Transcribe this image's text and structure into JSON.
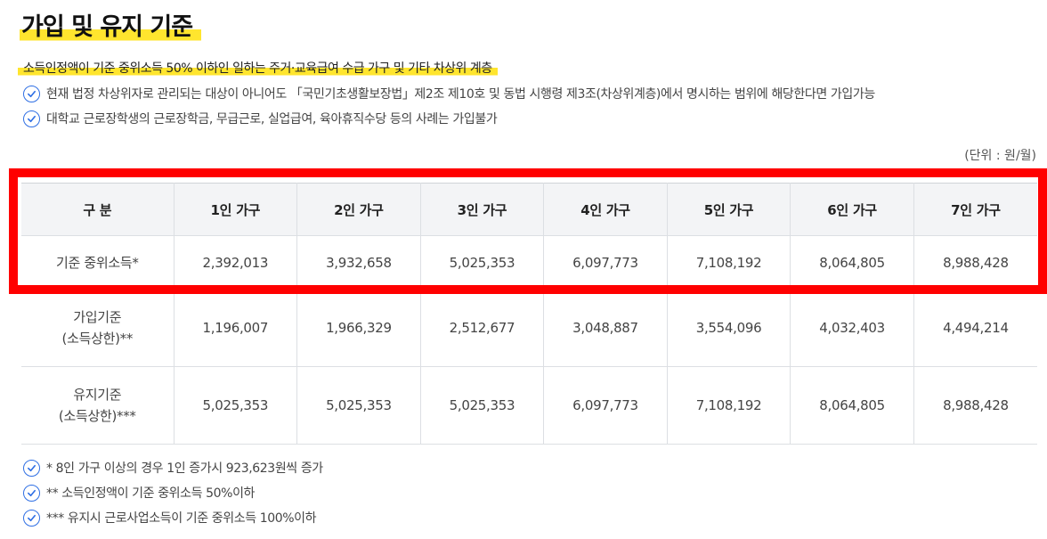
{
  "title": "가입 및 유지 기준",
  "subtitle": "소득인정액이 기준 중위소득 50% 이하인 일하는 주거·교육급여 수급 가구 및 기타 차상위 계층",
  "top_notes": [
    "현재 법정 차상위자로 관리되는 대상이 아니어도 「국민기초생활보장법」제2조 제10호 및 동법 시행령 제3조(차상위계층)에서 명시하는 범위에 해당한다면 가입가능",
    "대학교 근로장학생의 근로장학금, 무급근로, 실업급여, 육아휴직수당 등의 사례는 가입불가"
  ],
  "unit": "(단위 : 원/월)",
  "table": {
    "headers": [
      "구 분",
      "1인 가구",
      "2인 가구",
      "3인 가구",
      "4인 가구",
      "5인 가구",
      "6인 가구",
      "7인 가구"
    ],
    "rows": [
      {
        "label": [
          "기준 중위소득*"
        ],
        "values": [
          "2,392,013",
          "3,932,658",
          "5,025,353",
          "6,097,773",
          "7,108,192",
          "8,064,805",
          "8,988,428"
        ]
      },
      {
        "label": [
          "가입기준",
          "(소득상한)**"
        ],
        "values": [
          "1,196,007",
          "1,966,329",
          "2,512,677",
          "3,048,887",
          "3,554,096",
          "4,032,403",
          "4,494,214"
        ]
      },
      {
        "label": [
          "유지기준",
          "(소득상한)***"
        ],
        "values": [
          "5,025,353",
          "5,025,353",
          "5,025,353",
          "6,097,773",
          "7,108,192",
          "8,064,805",
          "8,988,428"
        ]
      }
    ]
  },
  "bottom_notes": [
    "* 8인 가구 이상의 경우 1인 증가시 923,623원씩 증가",
    "** 소득인정액이 기준 중위소득 50%이하",
    "*** 유지시 근로사업소득이 기준 중위소득 100%이하"
  ],
  "colors": {
    "highlight": "#ffe52e",
    "check": "#2f6fe4",
    "box": "#ff0000"
  }
}
